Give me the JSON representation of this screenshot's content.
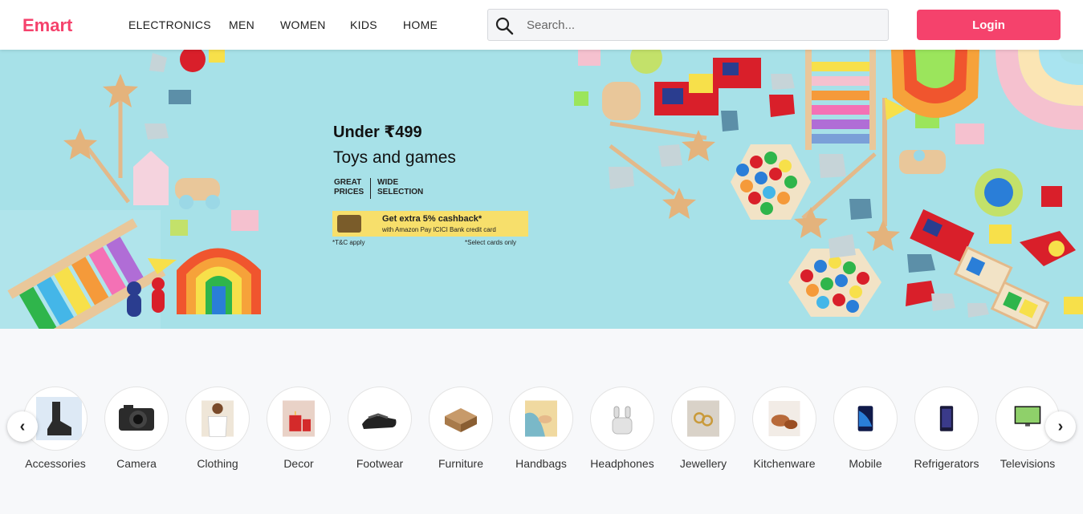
{
  "header": {
    "logo": "Emart",
    "nav": [
      "ELECTRONICS",
      "MEN",
      "WOMEN",
      "KIDS",
      "HOME"
    ],
    "search": {
      "placeholder": "Search..."
    },
    "login_label": "Login"
  },
  "banner": {
    "title": "Under ₹499",
    "subtitle": "Toys and games",
    "tag1": "GREAT PRICES",
    "tag2": "WIDE SELECTION",
    "cashback_title": "Get extra 5% cashback*",
    "cashback_sub": "with Amazon Pay ICICI Bank credit card",
    "tc_left": "*T&C apply",
    "tc_right": "*Select cards only"
  },
  "categories": [
    {
      "label": "Accessories",
      "icon": "accessories-thumbnail"
    },
    {
      "label": "Camera",
      "icon": "camera-thumbnail"
    },
    {
      "label": "Clothing",
      "icon": "clothing-thumbnail"
    },
    {
      "label": "Decor",
      "icon": "decor-thumbnail"
    },
    {
      "label": "Footwear",
      "icon": "footwear-thumbnail"
    },
    {
      "label": "Furniture",
      "icon": "furniture-thumbnail"
    },
    {
      "label": "Handbags",
      "icon": "handbags-thumbnail"
    },
    {
      "label": "Headphones",
      "icon": "headphones-thumbnail"
    },
    {
      "label": "Jewellery",
      "icon": "jewellery-thumbnail"
    },
    {
      "label": "Kitchenware",
      "icon": "kitchenware-thumbnail"
    },
    {
      "label": "Mobile",
      "icon": "mobile-thumbnail"
    },
    {
      "label": "Refrigerators",
      "icon": "refrigerator-thumbnail"
    },
    {
      "label": "Televisions",
      "icon": "television-thumbnail"
    }
  ],
  "carousel": {
    "prev_icon": "chevron-left-icon",
    "next_icon": "chevron-right-icon"
  },
  "colors": {
    "brand": "#f5426c",
    "banner_bg": "#a7e1e8",
    "cashback_bg": "#f7df6b"
  }
}
